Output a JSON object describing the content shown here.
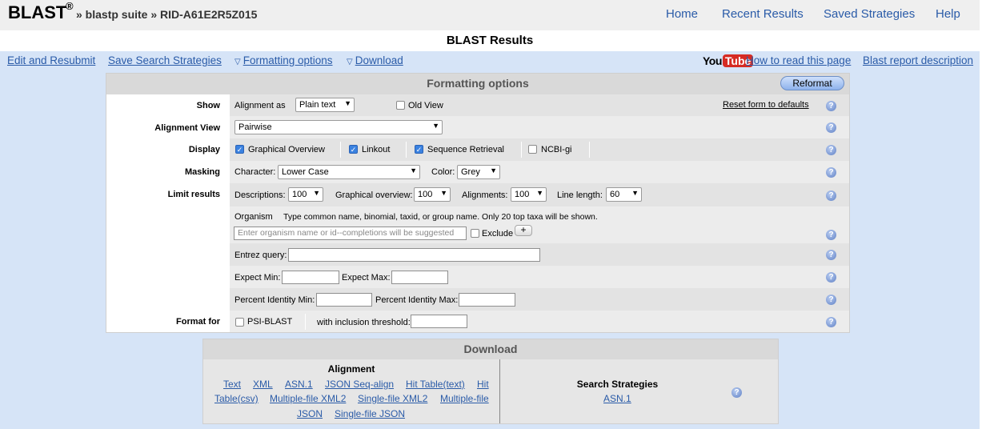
{
  "header": {
    "logo": "BLAST",
    "logo_mark": "®",
    "breadcrumb": "» blastp suite » RID-A61E2R5Z015",
    "nav": [
      "Home",
      "Recent Results",
      "Saved Strategies",
      "Help"
    ]
  },
  "page_title": "BLAST Results",
  "toolbar": {
    "edit_resubmit": "Edit and Resubmit",
    "save_strategies": "Save Search Strategies",
    "formatting_options": "Formatting options",
    "download": "Download",
    "youtube_you": "You",
    "youtube_tube": "Tube",
    "how_to_read": "How to read this page",
    "report_description": "Blast report description",
    "triangle": "▽"
  },
  "formatting": {
    "title": "Formatting options",
    "reformat": "Reformat",
    "help_glyph": "?",
    "show": {
      "label": "Show",
      "alignment_as": "Alignment as",
      "alignment_as_value": "Plain text",
      "old_view": "Old View",
      "reset": "Reset form to defaults"
    },
    "alignment_view": {
      "label": "Alignment View",
      "value": "Pairwise"
    },
    "display": {
      "label": "Display",
      "graphical_overview": "Graphical Overview",
      "linkout": "Linkout",
      "sequence_retrieval": "Sequence Retrieval",
      "ncbi_gi": "NCBI-gi"
    },
    "masking": {
      "label": "Masking",
      "character": "Character:",
      "character_value": "Lower Case",
      "color": "Color:",
      "color_value": "Grey"
    },
    "limit": {
      "label": "Limit results",
      "descriptions": "Descriptions:",
      "descriptions_value": "100",
      "graphical_overview": "Graphical overview:",
      "graphical_overview_value": "100",
      "alignments": "Alignments:",
      "alignments_value": "100",
      "line_length": "Line length:",
      "line_length_value": "60"
    },
    "organism": {
      "label": "Organism",
      "hint": "Type common name, binomial, taxid, or group name. Only 20 top taxa will be shown.",
      "placeholder": "Enter organism name or id--completions will be suggested",
      "exclude": "Exclude",
      "plus": "+"
    },
    "entrez": {
      "label": "Entrez query:"
    },
    "expect": {
      "min": "Expect Min:",
      "max": "Expect Max:"
    },
    "identity": {
      "min": "Percent Identity Min:",
      "max": "Percent Identity Max:"
    },
    "format_for": {
      "label": "Format for",
      "psi_blast": "PSI-BLAST",
      "threshold": "with inclusion threshold:"
    }
  },
  "download": {
    "title": "Download",
    "alignment_head": "Alignment",
    "alignment_links": [
      "Text",
      "XML",
      "ASN.1",
      "JSON Seq-align",
      "Hit Table(text)",
      "Hit",
      "Table(csv)",
      "Multiple-file XML2",
      "Single-file XML2",
      "Multiple-file",
      "JSON",
      "Single-file JSON"
    ],
    "strategies_head": "Search Strategies",
    "strategies_link": "ASN.1"
  }
}
